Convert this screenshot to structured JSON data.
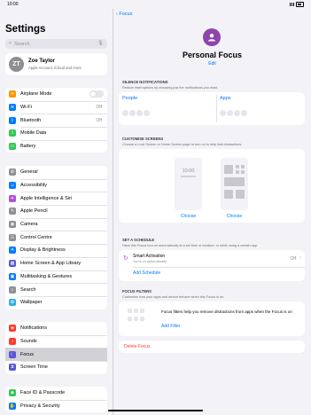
{
  "status": {
    "time": "10:00"
  },
  "sidebar": {
    "title": "Settings",
    "search_placeholder": "Search",
    "profile": {
      "initials": "ZT",
      "name": "Zoe Taylor",
      "subtitle": "Apple Account, iCloud and more"
    },
    "group1": [
      {
        "label": "Airplane Mode",
        "icon": "airplane-icon",
        "color": "#ff9500",
        "glyph": "✈",
        "toggle": true
      },
      {
        "label": "Wi-Fi",
        "icon": "wifi-icon",
        "color": "#007aff",
        "glyph": "≋",
        "value": "Off"
      },
      {
        "label": "Bluetooth",
        "icon": "bluetooth-icon",
        "color": "#007aff",
        "glyph": "ᛒ",
        "value": "Off"
      },
      {
        "label": "Mobile Data",
        "icon": "antenna-icon",
        "color": "#34c759",
        "glyph": "⟟"
      },
      {
        "label": "Battery",
        "icon": "battery-icon",
        "color": "#34c759",
        "glyph": "▭"
      }
    ],
    "group2": [
      {
        "label": "General",
        "icon": "gear-icon",
        "color": "#8e8e93",
        "glyph": "⚙"
      },
      {
        "label": "Accessibility",
        "icon": "accessibility-icon",
        "color": "#007aff",
        "glyph": "☺"
      },
      {
        "label": "Apple Intelligence & Siri",
        "icon": "siri-icon",
        "color": "#af52de",
        "glyph": "✦"
      },
      {
        "label": "Apple Pencil",
        "icon": "pencil-icon",
        "color": "#8e8e93",
        "glyph": "✎"
      },
      {
        "label": "Camera",
        "icon": "camera-icon",
        "color": "#8e8e93",
        "glyph": "◉"
      },
      {
        "label": "Control Centre",
        "icon": "control-centre-icon",
        "color": "#8e8e93",
        "glyph": "☷"
      },
      {
        "label": "Display & Brightness",
        "icon": "brightness-icon",
        "color": "#007aff",
        "glyph": "☀"
      },
      {
        "label": "Home Screen & App Library",
        "icon": "home-screen-icon",
        "color": "#5856d6",
        "glyph": "▦"
      },
      {
        "label": "Multitasking & Gestures",
        "icon": "multitasking-icon",
        "color": "#007aff",
        "glyph": "▣"
      },
      {
        "label": "Search",
        "icon": "search-icon",
        "color": "#8e8e93",
        "glyph": "⌕"
      },
      {
        "label": "Wallpaper",
        "icon": "wallpaper-icon",
        "color": "#32ade6",
        "glyph": "✿"
      }
    ],
    "group3": [
      {
        "label": "Notifications",
        "icon": "bell-icon",
        "color": "#ff3b30",
        "glyph": "◈"
      },
      {
        "label": "Sounds",
        "icon": "speaker-icon",
        "color": "#ff3b30",
        "glyph": "♪"
      },
      {
        "label": "Focus",
        "icon": "moon-icon",
        "color": "#5856d6",
        "glyph": "☾",
        "selected": true
      },
      {
        "label": "Screen Time",
        "icon": "hourglass-icon",
        "color": "#5856d6",
        "glyph": "⧗"
      }
    ],
    "group4": [
      {
        "label": "Face ID & Passcode",
        "icon": "faceid-icon",
        "color": "#34c759",
        "glyph": "☻"
      },
      {
        "label": "Privacy & Security",
        "icon": "hand-icon",
        "color": "#007aff",
        "glyph": "✋"
      }
    ]
  },
  "detail": {
    "back_label": "Focus",
    "focus_name": "Personal Focus",
    "edit_label": "Edit",
    "silence": {
      "heading": "SILENCE NOTIFICATIONS",
      "subtitle": "Reduce interruptions by choosing just the notifications you want.",
      "people_label": "People",
      "apps_label": "Apps"
    },
    "screens": {
      "heading": "CUSTOMISE SCREENS",
      "subtitle": "Choose a Lock Screen or Home Screen page to turn on to help limit distractions.",
      "lock_time": "10:00",
      "choose1": "Choose",
      "choose2": "Choose"
    },
    "schedule": {
      "heading": "SET A SCHEDULE",
      "subtitle": "Have this Focus turn on automatically at a set time or location, or while using a certain app.",
      "smart_title": "Smart Activation",
      "smart_sub": "Turns on automatically",
      "smart_value": "Off",
      "add_label": "Add Schedule"
    },
    "filters": {
      "heading": "FOCUS FILTERS",
      "subtitle": "Customise how your apps and device behave when this Focus is on.",
      "text": "Focus filters help you remove distractions from apps when the Focus is on",
      "add_label": "Add Filter"
    },
    "delete_label": "Delete Focus"
  }
}
